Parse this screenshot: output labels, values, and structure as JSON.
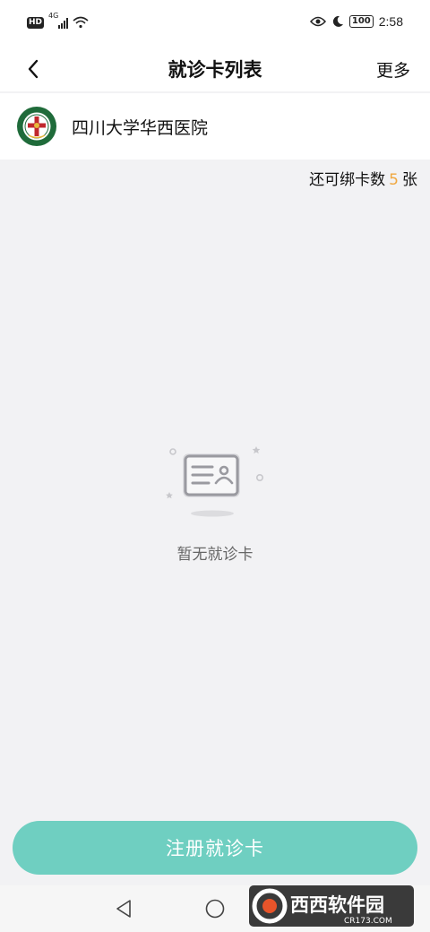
{
  "status_bar": {
    "hd": "HD",
    "network": "4G",
    "battery": "100",
    "time": "2:58"
  },
  "nav": {
    "title": "就诊卡列表",
    "more_label": "更多"
  },
  "hospital": {
    "name": "四川大学华西医院"
  },
  "binding": {
    "prefix": "还可绑卡数",
    "count": "5",
    "suffix": "张"
  },
  "empty_state": {
    "text": "暂无就诊卡"
  },
  "register_button": {
    "label": "注册就诊卡"
  },
  "watermark": {
    "brand": "西西软件园",
    "site": "CR173.COM"
  },
  "colors": {
    "accent": "#6fcfc1",
    "count": "#f0a840",
    "page_bg": "#f2f2f4"
  }
}
